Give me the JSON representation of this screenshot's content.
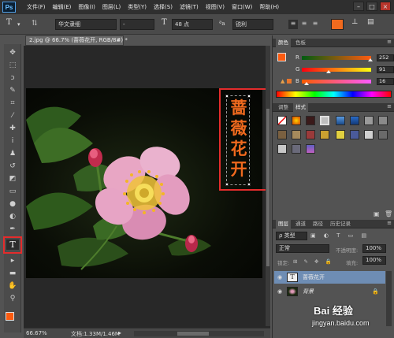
{
  "app": {
    "logo": "Ps"
  },
  "menu": [
    "文件(F)",
    "编辑(E)",
    "图像(I)",
    "图层(L)",
    "类型(Y)",
    "选择(S)",
    "滤镜(T)",
    "视图(V)",
    "窗口(W)",
    "帮助(H)"
  ],
  "window_controls": {
    "minimize": "–",
    "restore": "□",
    "close": "×"
  },
  "options_bar": {
    "font_family": "华文隶细",
    "font_style": "-",
    "font_size": "48 点",
    "anti_alias": "锐利",
    "text_color": "#f06a1e"
  },
  "document": {
    "tab_title": "2.jpg @ 66.7% (蔷薇花开, RGB/8#) *",
    "tab_close": "×",
    "overlay_text": [
      "蔷",
      "薇",
      "花",
      "开"
    ],
    "zoom": "66.67%",
    "doc_info": "文档:1.33M/1.46M"
  },
  "color_panel": {
    "tabs": [
      "颜色",
      "色板"
    ],
    "r_label": "R",
    "r": "252",
    "g_label": "G",
    "g": "91",
    "b_label": "B",
    "b": "16",
    "foreground": "#fc5b10"
  },
  "styles_panel": {
    "tabs": [
      "调整",
      "样式"
    ]
  },
  "layers_panel": {
    "tabs": [
      "图层",
      "通道",
      "路径",
      "历史记录"
    ],
    "filter_label": "ρ 类型",
    "blend_mode": "正常",
    "opacity_label": "不透明度:",
    "opacity": "100%",
    "lock_label": "锁定:",
    "fill_label": "填充:",
    "fill": "100%",
    "layers": [
      {
        "name": "蔷薇花开",
        "thumb": "T",
        "selected": true
      },
      {
        "name": "背景",
        "thumb": "",
        "selected": false
      }
    ],
    "lock_icon": "🔒"
  },
  "watermark": {
    "brand": "Bai 经验",
    "url": "jingyan.baidu.com"
  }
}
